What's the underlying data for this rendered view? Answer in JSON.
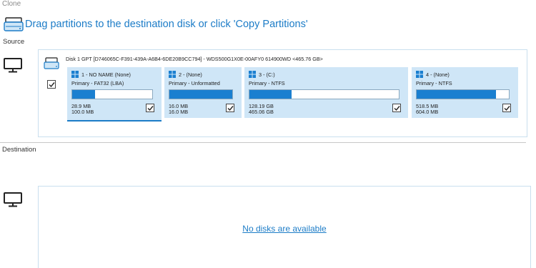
{
  "window": {
    "title": "Clone"
  },
  "header": {
    "instruction": "Drag partitions to the destination disk or click 'Copy Partitions'",
    "icon": "clone-disk-icon"
  },
  "colors": {
    "accent": "#1c7cc7",
    "partition_bg": "#cfe6f7",
    "bar_fill": "#1a7fd0"
  },
  "source": {
    "label": "Source",
    "disk": {
      "info": "Disk 1 GPT [D746065C-F391-439A-A6B4-6DE20B9CC794] - WDS500G1X0E-00AFY0 614900WD  <465.76 GB>",
      "checked": true,
      "partitions": [
        {
          "name": "1 - NO NAME (None)",
          "type": "Primary - FAT32 (LBA)",
          "used": "28.9 MB",
          "total": "100.0 MB",
          "fill": 0.29,
          "checked": true,
          "selected": true
        },
        {
          "name": "2 - (None)",
          "type": "Primary - Unformatted",
          "used": "16.0 MB",
          "total": "16.0 MB",
          "fill": 1.0,
          "checked": true,
          "selected": false
        },
        {
          "name": "3 - (C:)",
          "type": "Primary - NTFS",
          "used": "128.19 GB",
          "total": "465.06 GB",
          "fill": 0.28,
          "checked": true,
          "selected": false
        },
        {
          "name": "4 - (None)",
          "type": "Primary - NTFS",
          "used": "518.5 MB",
          "total": "604.0 MB",
          "fill": 0.86,
          "checked": true,
          "selected": false
        }
      ]
    }
  },
  "destination": {
    "label": "Destination",
    "empty_link": "No disks are available"
  }
}
